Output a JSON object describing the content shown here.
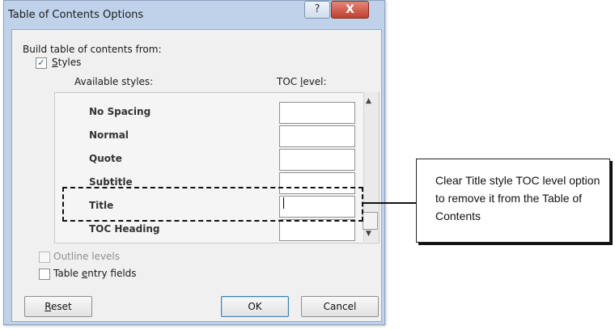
{
  "dialog": {
    "title": "Table of Contents Options",
    "help_glyph": "?",
    "close_glyph": "X",
    "build_label": "Build table of contents from:",
    "styles_checkbox": {
      "label": "Styles",
      "checked": true,
      "check_glyph": "✓"
    },
    "list_headers": {
      "available": "Available styles:",
      "toc_level": "TOC level:"
    },
    "styles": [
      {
        "name": "No Spacing",
        "toc_level": ""
      },
      {
        "name": "Normal",
        "toc_level": ""
      },
      {
        "name": "Quote",
        "toc_level": ""
      },
      {
        "name": "Subtitle",
        "toc_level": ""
      },
      {
        "name": "Title",
        "toc_level": ""
      },
      {
        "name": "TOC Heading",
        "toc_level": ""
      }
    ],
    "scroll_up_glyph": "▲",
    "scroll_down_glyph": "▼",
    "outline_levels": {
      "label": "Outline levels",
      "checked": false,
      "enabled": false
    },
    "table_entry_fields": {
      "label": "Table entry fields",
      "checked": false
    },
    "buttons": {
      "reset": "Reset",
      "ok": "OK",
      "cancel": "Cancel"
    }
  },
  "callout": {
    "text": "Clear Title style TOC level option to remove it from the Table of Contents"
  }
}
